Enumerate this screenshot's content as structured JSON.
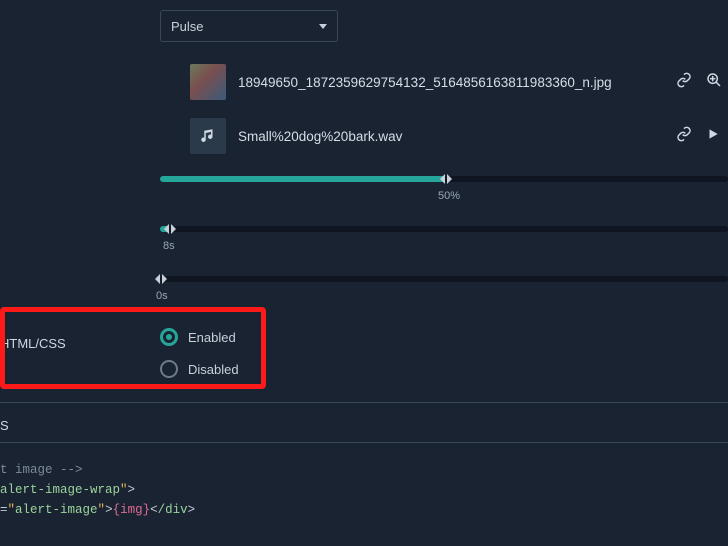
{
  "dropdown": {
    "selected": "Pulse"
  },
  "files": {
    "image": {
      "name": "18949650_1872359629754132_5164856163811983360_n.jpg"
    },
    "audio": {
      "name": "Small%20dog%20bark.wav"
    }
  },
  "sliders": {
    "main": {
      "percent": 50,
      "label": "50%"
    },
    "fadeOut": {
      "value": 8,
      "label": "8s"
    },
    "delay": {
      "value": 0,
      "label": "0s"
    }
  },
  "sidebar": {
    "htmlcss": "HTML/CSS",
    "s": "S"
  },
  "radios": {
    "enabled": "Enabled",
    "disabled": "Disabled"
  },
  "code": {
    "comment_line": "t image -->",
    "line1_class": "alert-image-wrap",
    "line2_attr_prefix": "=",
    "line2_class": "alert-image",
    "line2_var": "{img}",
    "div_open": "div",
    "div_close": "/div"
  }
}
